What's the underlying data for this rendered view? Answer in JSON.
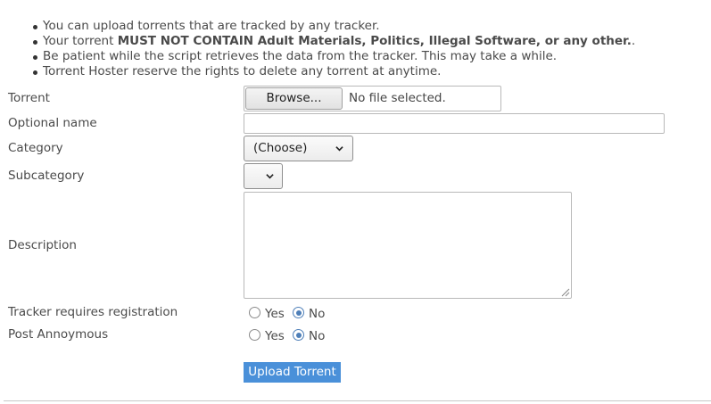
{
  "rules": [
    {
      "pre": "You can upload torrents that are tracked by any tracker.",
      "strong": "",
      "post": ""
    },
    {
      "pre": "Your torrent ",
      "strong": "MUST NOT CONTAIN Adult Materials, Politics, Illegal Software, or any other.",
      "post": "."
    },
    {
      "pre": "Be patient while the script retrieves the data from the tracker. This may take a while.",
      "strong": "",
      "post": ""
    },
    {
      "pre": "Torrent Hoster reserve the rights to delete any torrent at anytime.",
      "strong": "",
      "post": ""
    }
  ],
  "form": {
    "torrent": {
      "label": "Torrent",
      "browse_label": "Browse...",
      "file_status": "No file selected."
    },
    "name": {
      "label": "Optional name",
      "value": ""
    },
    "category": {
      "label": "Category",
      "selected": "(Choose)"
    },
    "subcategory": {
      "label": "Subcategory",
      "selected": ""
    },
    "description": {
      "label": "Description",
      "value": ""
    },
    "tracker_registration": {
      "label": "Tracker requires registration",
      "yes": "Yes",
      "no": "No",
      "selected": "No"
    },
    "anonymous": {
      "label": "Post Annoymous",
      "yes": "Yes",
      "no": "No",
      "selected": "No"
    },
    "submit_label": "Upload Torrent"
  },
  "colors": {
    "button_accent": "#4a90d9",
    "radio_checked": "#4e7fb8"
  }
}
